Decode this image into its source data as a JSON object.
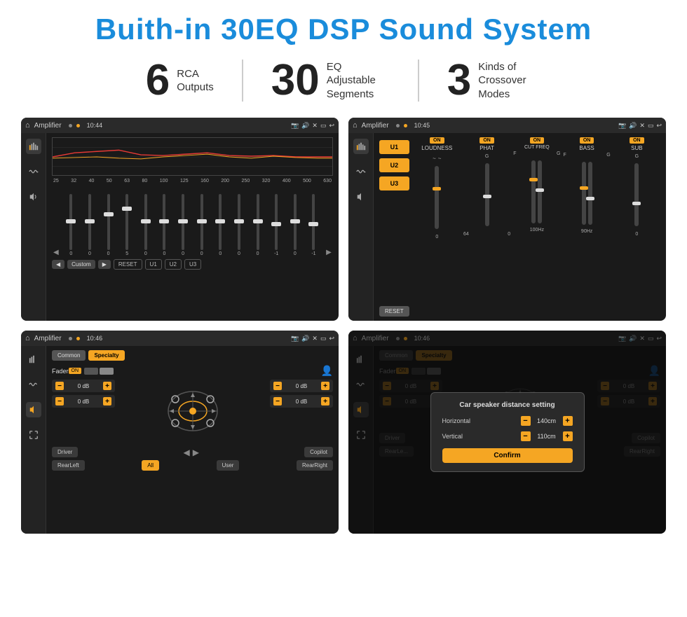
{
  "title": "Buith-in 30EQ DSP Sound System",
  "stats": [
    {
      "number": "6",
      "label": "RCA\nOutputs"
    },
    {
      "number": "30",
      "label": "EQ Adjustable\nSegments"
    },
    {
      "number": "3",
      "label": "Kinds of\nCrossover Modes"
    }
  ],
  "screens": [
    {
      "id": "eq-screen",
      "topbar": {
        "title": "Amplifier",
        "time": "10:44"
      },
      "type": "eq"
    },
    {
      "id": "crossover-screen",
      "topbar": {
        "title": "Amplifier",
        "time": "10:45"
      },
      "type": "crossover"
    },
    {
      "id": "fader-screen",
      "topbar": {
        "title": "Amplifier",
        "time": "10:46"
      },
      "type": "fader"
    },
    {
      "id": "dialog-screen",
      "topbar": {
        "title": "Amplifier",
        "time": "10:46"
      },
      "type": "dialog"
    }
  ],
  "eq": {
    "freqs": [
      "25",
      "32",
      "40",
      "50",
      "63",
      "80",
      "100",
      "125",
      "160",
      "200",
      "250",
      "320",
      "400",
      "500",
      "630"
    ],
    "values": [
      "0",
      "0",
      "0",
      "5",
      "0",
      "0",
      "0",
      "0",
      "0",
      "0",
      "0",
      "-1",
      "0",
      "-1"
    ],
    "buttons": [
      "Custom",
      "RESET",
      "U1",
      "U2",
      "U3"
    ]
  },
  "crossover": {
    "u_labels": [
      "U1",
      "U2",
      "U3"
    ],
    "panels": [
      "LOUDNESS",
      "PHAT",
      "CUT FREQ",
      "BASS",
      "SUB"
    ],
    "reset_label": "RESET"
  },
  "fader": {
    "tabs": [
      "Common",
      "Specialty"
    ],
    "active_tab": "Specialty",
    "fader_label": "Fader",
    "on_label": "ON",
    "zones": [
      {
        "label": "0 dB"
      },
      {
        "label": "0 dB"
      },
      {
        "label": "0 dB"
      },
      {
        "label": "0 dB"
      }
    ],
    "positions": [
      "Driver",
      "RearLeft",
      "All",
      "User",
      "RearRight",
      "Copilot"
    ]
  },
  "dialog": {
    "title": "Car speaker distance setting",
    "rows": [
      {
        "label": "Horizontal",
        "value": "140cm"
      },
      {
        "label": "Vertical",
        "value": "110cm"
      }
    ],
    "confirm_label": "Confirm",
    "fader_tabs": [
      "Common",
      "Specialty"
    ],
    "right_zone1": "0 dB",
    "right_zone2": "0 dB"
  }
}
